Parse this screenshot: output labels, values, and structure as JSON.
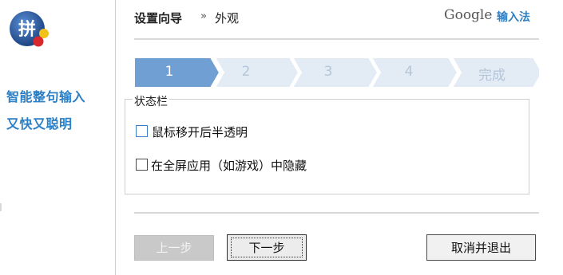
{
  "app": {
    "logo_char": "拼",
    "tagline": [
      "智能整句输入",
      "又快又聪明"
    ]
  },
  "header": {
    "title": "设置向导",
    "separator": "»",
    "current": "外观",
    "brand_google": "Google",
    "brand_ime": "输入法"
  },
  "steps": {
    "items": [
      "1",
      "2",
      "3",
      "4",
      "完成"
    ],
    "active_index": 0,
    "active_color": "#6f9fd3",
    "inactive_color": "#e3ebf5"
  },
  "status_bar": {
    "legend": "状态栏",
    "options": [
      {
        "label": "鼠标移开后半透明",
        "checked": false
      },
      {
        "label": "在全屏应用（如游戏）中隐藏",
        "checked": false
      }
    ]
  },
  "buttons": {
    "prev": "上一步",
    "next": "下一步",
    "cancel": "取消并退出"
  }
}
